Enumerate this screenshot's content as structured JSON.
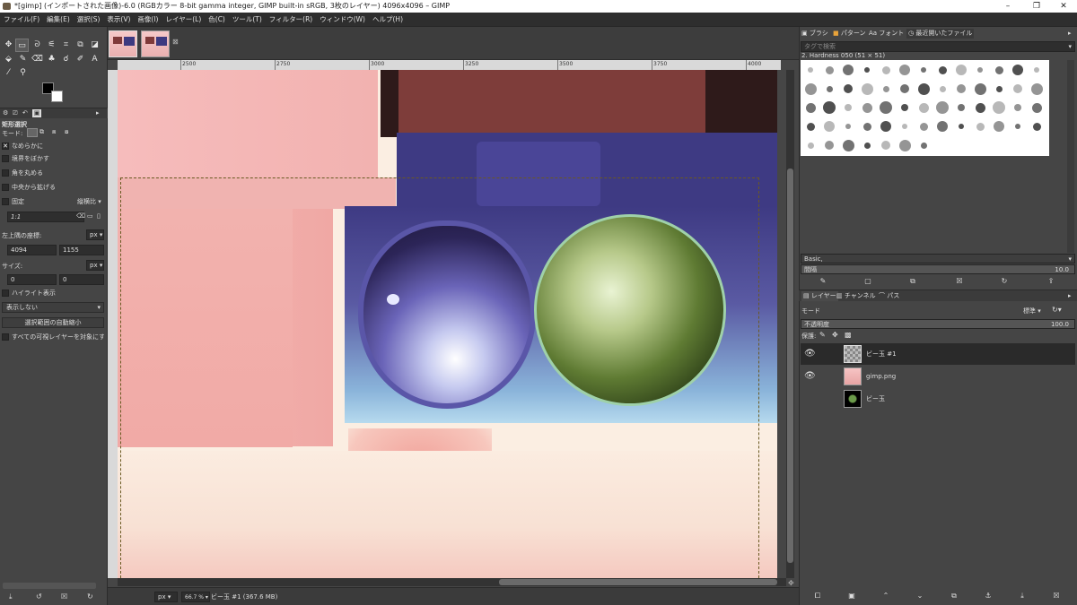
{
  "window": {
    "title": "*[gimp] (インポートされた画像)-6.0 (RGBカラー 8-bit gamma integer, GIMP built-in sRGB, 3枚のレイヤー) 4096x4096 – GIMP",
    "min": "–",
    "max": "❐",
    "close": "✕"
  },
  "menu": [
    "ファイル(F)",
    "編集(E)",
    "選択(S)",
    "表示(V)",
    "画像(I)",
    "レイヤー(L)",
    "色(C)",
    "ツール(T)",
    "フィルター(R)",
    "ウィンドウ(W)",
    "ヘルプ(H)"
  ],
  "tool_options": {
    "title": "矩形選択",
    "mode_label": "モード:",
    "antialias": "なめらかに",
    "feather": "境界をぼかす",
    "rounded": "角を丸める",
    "expand_center": "中央から拡げる",
    "fixed_label": "固定",
    "fixed_value": "縦横比",
    "ratio": "1:1",
    "position_label": "左上隅の座標:",
    "unit1": "px",
    "pos_x": "4094",
    "pos_y": "1155",
    "size_label": "サイズ:",
    "unit2": "px",
    "size_w": "0",
    "size_h": "0",
    "highlight": "ハイライト表示",
    "guides": "表示しない",
    "autoshrink": "選択範囲の自動縮小",
    "sample_merged": "すべての可視レイヤーを対象にす"
  },
  "ruler": {
    "ticks": [
      "2500",
      "2750",
      "3000",
      "3250",
      "3500",
      "3750",
      "4000"
    ]
  },
  "status": {
    "unit": "px",
    "zoom": "66.7 %",
    "text": "ビー玉 #1 (367.6 MB)"
  },
  "dock": {
    "tabs": [
      "ブラシ",
      "パターン",
      "フォント",
      "最近開いたファイル"
    ],
    "tag_placeholder": "タグで検索",
    "brush_name": "2. Hardness 050 (51 × 51)",
    "preset": "Basic,",
    "spacing_label": "間隔",
    "spacing_value": "10.0",
    "layer_tabs": [
      "レイヤー",
      "チャンネル",
      "パス"
    ],
    "mode_label": "モード",
    "mode_value": "標準",
    "opacity_label": "不透明度",
    "opacity_value": "100.0",
    "lock_label": "保護:",
    "layers": [
      {
        "name": "ビー玉 #1"
      },
      {
        "name": "gimp.png"
      },
      {
        "name": "ビー玉"
      }
    ]
  }
}
